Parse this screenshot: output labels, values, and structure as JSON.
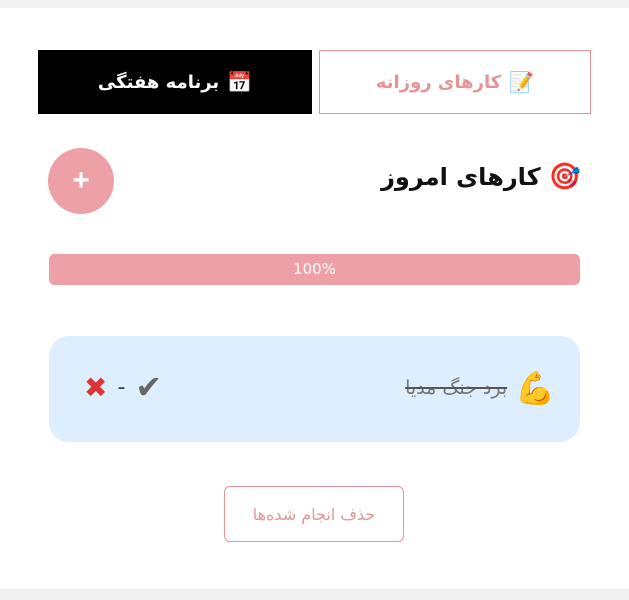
{
  "tabs": {
    "weekly": {
      "label": "برنامه هفتگی",
      "icon": "📅",
      "active": true
    },
    "daily": {
      "label": "کارهای روزانه",
      "icon": "📝",
      "active": false
    }
  },
  "header": {
    "title": "کارهای امروز",
    "title_icon": "🎯",
    "add_label": "+"
  },
  "progress": {
    "value": 100,
    "label": "100%"
  },
  "tasks": [
    {
      "text": "برد جنگ مدیا",
      "icon": "💪",
      "done": true,
      "check_symbol": "✔",
      "separator": "-",
      "delete_symbol": "✖"
    }
  ],
  "footer": {
    "clear_done_label": "حذف انجام شده‌ها"
  },
  "colors": {
    "accent": "#eda1a6",
    "accent_text": "#e79497",
    "card_bg": "#ddeeff",
    "tab_active_bg": "#000000"
  }
}
